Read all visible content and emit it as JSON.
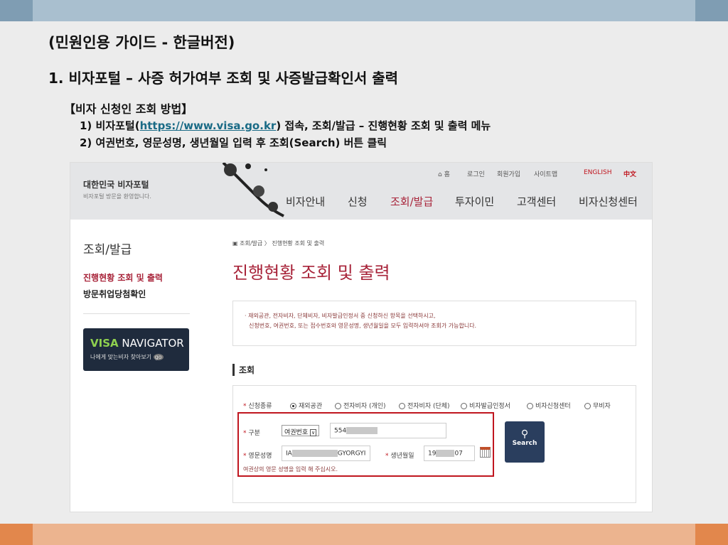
{
  "slide": {
    "title": "(민원인용 가이드 - 한글버전)",
    "heading": "1. 비자포털 – 사증 허가여부 조회 및 사증발급확인서 출력",
    "subheading": "【비자 신청인 조회 방법】",
    "step1_pre": "1) 비자포털(",
    "step1_link": "https://www.visa.go.kr",
    "step1_post": ") 접속, 조회/발급 – 진행현황 조회 및 출력 메뉴",
    "step2": "2) 여권번호, 영문성명, 생년월일 입력 후 조회(Search) 버튼 클릭"
  },
  "site": {
    "logo_title": "대한민국 비자포털",
    "logo_sub": "비자포털 방문을 환영합니다.",
    "util": [
      "홈",
      "로그인",
      "회원가입",
      "사이트맵",
      "ENGLISH",
      "中文"
    ],
    "gnb": [
      "비자안내",
      "신청",
      "조회/발급",
      "투자이민",
      "고객센터",
      "비자신청센터"
    ],
    "side_title": "조회/발급",
    "side_items": [
      "진행현황 조회 및 출력",
      "방문취업당첨확인"
    ],
    "visa_nav": {
      "bold": "VISA",
      "rest": " NAVIGATOR",
      "sub": "나에게 맞는비자 찾아보기",
      "go": "go"
    },
    "breadcrumb": [
      "조회/발급",
      "진행현황 조회 및 출력"
    ],
    "page_title": "진행현황 조회 및 출력",
    "notice": [
      "· 재외공관, 전자비자, 단체비자, 비자발급인정서 중 신청하신 항목을 선택하시고,",
      "신청번호, 여권번호, 또는 접수번호와 영문성명, 생년월일을 모두 입력하셔야 조회가 가능합니다."
    ],
    "section": "조회",
    "form": {
      "type_label": "신청종류",
      "types": [
        "재외공관",
        "전자비자 (개인)",
        "전자비자 (단체)",
        "비자발급인정서",
        "비자신청센터",
        "무비자"
      ],
      "kind_label": "구분",
      "kind_value": "여권번호",
      "passport_prefix": "554",
      "name_label": "영문성명",
      "name_prefix": "IA",
      "name_suffix": "GYORGYI",
      "birth_label": "생년월일",
      "birth_prefix": "19",
      "birth_suffix": "07",
      "search": "Search",
      "hint": "여권상의 영문 성명을 입력 해 주십시오."
    }
  },
  "colors": {
    "accent": "#a8243a",
    "highlight": "#c0161f",
    "button": "#2a3e5e"
  }
}
